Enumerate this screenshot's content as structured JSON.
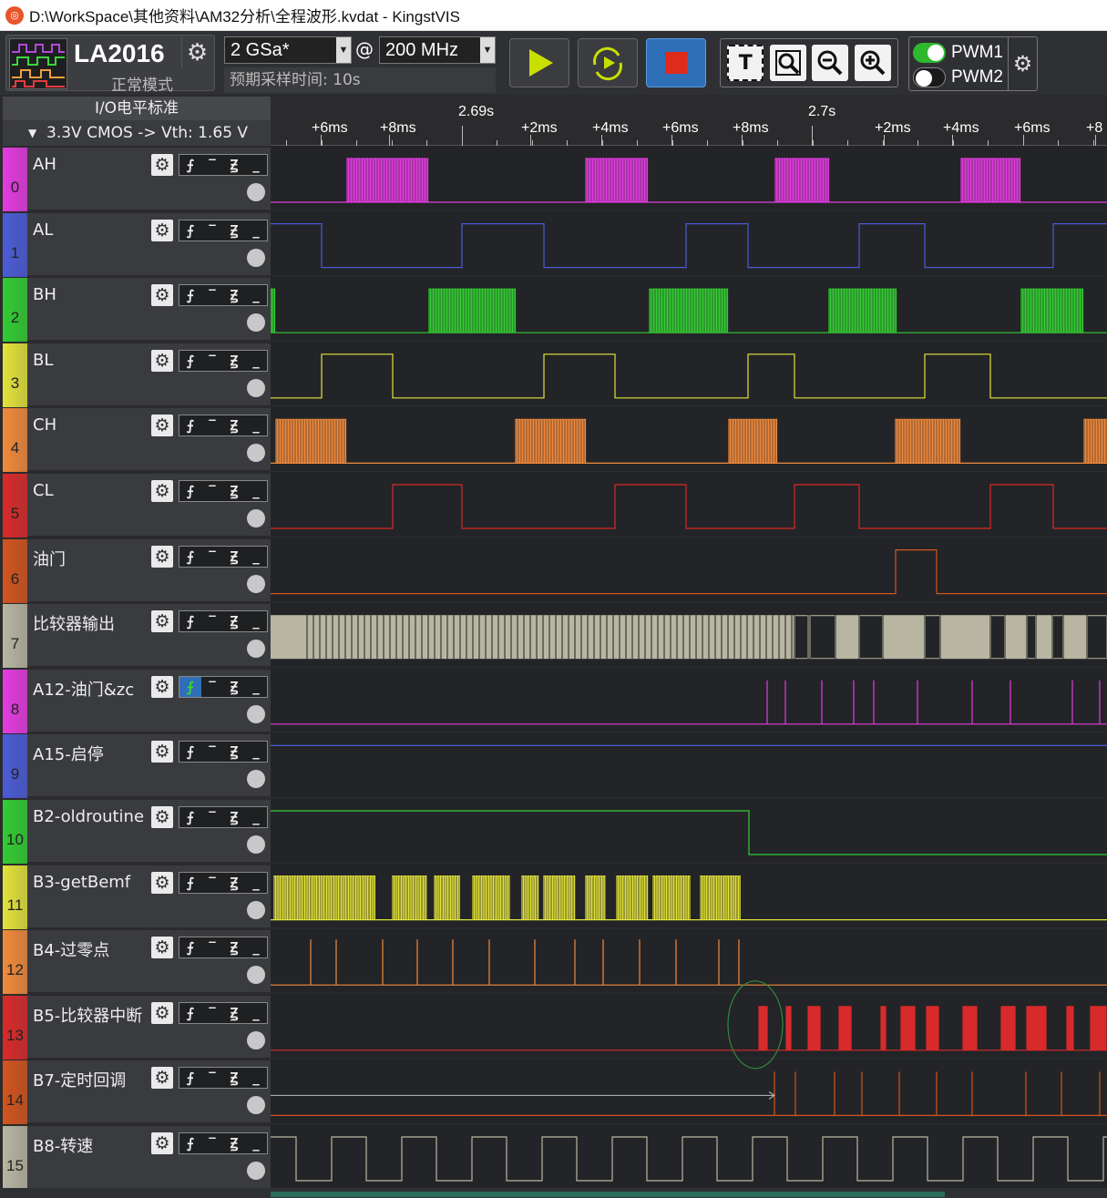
{
  "window": {
    "title": "D:\\WorkSpace\\其他资料\\AM32分析\\全程波形.kvdat - KingstVIS",
    "icon": "kingst-logo-icon"
  },
  "device": {
    "name": "LA2016",
    "mode": "正常模式"
  },
  "sampling": {
    "rate": "2 GSa*",
    "at": "@",
    "frequency": "200 MHz",
    "expected_time": "预期采样时间: 10s"
  },
  "pwm": [
    {
      "label": "PWM1",
      "on": true
    },
    {
      "label": "PWM2",
      "on": false
    }
  ],
  "io": {
    "title": "I/O电平标准",
    "standard": "3.3V CMOS  -> Vth: 1.65 V"
  },
  "ruler": {
    "labels": [
      "+6ms",
      "+8ms",
      "2.69s",
      "+2ms",
      "+4ms",
      "+6ms",
      "+8ms",
      "2.7s",
      "+2ms",
      "+4ms",
      "+6ms",
      "+8"
    ]
  },
  "trigger_glyphs": [
    "⨍",
    "‾",
    "Ꙃ",
    "_"
  ],
  "channels": [
    {
      "num": "0",
      "name": "AH",
      "color": "#e33be0"
    },
    {
      "num": "1",
      "name": "AL",
      "color": "#4b5bd6"
    },
    {
      "num": "2",
      "name": "BH",
      "color": "#33cc33"
    },
    {
      "num": "3",
      "name": "BL",
      "color": "#e3e33b"
    },
    {
      "num": "4",
      "name": "CH",
      "color": "#f08a3c"
    },
    {
      "num": "5",
      "name": "CL",
      "color": "#d82a2a"
    },
    {
      "num": "6",
      "name": "油门",
      "color": "#d2541e"
    },
    {
      "num": "7",
      "name": "比较器输出",
      "color": "#b8b6a2"
    },
    {
      "num": "8",
      "name": "A12-油门&zc",
      "color": "#e33be0"
    },
    {
      "num": "9",
      "name": "A15-启停",
      "color": "#4b5bd6"
    },
    {
      "num": "10",
      "name": "B2-oldroutine",
      "color": "#33cc33"
    },
    {
      "num": "11",
      "name": "B3-getBemf",
      "color": "#e3e33b"
    },
    {
      "num": "12",
      "name": "B4-过零点",
      "color": "#f08a3c"
    },
    {
      "num": "13",
      "name": "B5-比较器中断",
      "color": "#d82a2a"
    },
    {
      "num": "14",
      "name": "B7-定时回调",
      "color": "#d2541e"
    },
    {
      "num": "15",
      "name": "B8-转速",
      "color": "#b8b6a2"
    }
  ]
}
